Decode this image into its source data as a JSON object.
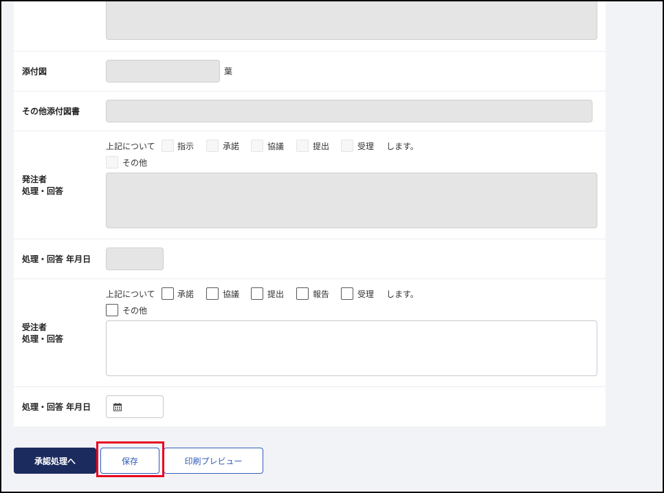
{
  "form": {
    "attachment_label": "添付図",
    "attachment_unit": "葉",
    "other_docs_label": "その他添付図書",
    "orderer": {
      "label_line1": "発注者",
      "label_line2": "処理・回答",
      "prefix": "上記について",
      "options": [
        "指示",
        "承諾",
        "協議",
        "提出",
        "受理"
      ],
      "suffix": "します。",
      "other_label": "その他"
    },
    "orderer_date_label": "処理・回答 年月日",
    "contractor": {
      "label_line1": "受注者",
      "label_line2": "処理・回答",
      "prefix": "上記について",
      "options": [
        "承諾",
        "協議",
        "提出",
        "報告",
        "受理"
      ],
      "suffix": "します。",
      "other_label": "その他"
    },
    "contractor_date_label": "処理・回答 年月日"
  },
  "footer": {
    "approve_label": "承認処理へ",
    "save_label": "保存",
    "print_preview_label": "印刷プレビュー"
  },
  "colors": {
    "primary": "#1b2b5e",
    "outline": "#2f5bb7",
    "highlight": "#e8001c"
  }
}
